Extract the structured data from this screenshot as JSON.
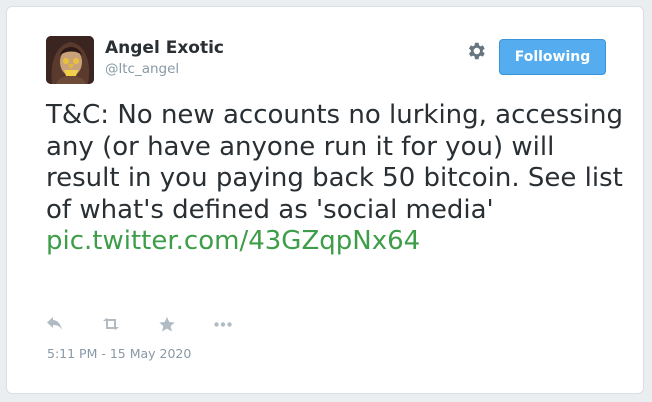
{
  "user": {
    "name": "Angel Exotic",
    "handle": "@ltc_angel",
    "avatar_icon": "profile-photo"
  },
  "header": {
    "settings_icon": "gear-icon",
    "follow_label": "Following"
  },
  "tweet": {
    "text": "T&C: No new accounts no lurking, accessing any (or have anyone run it for you) will result in you paying back 50 bitcoin. See list of what's defined as 'social media'",
    "link": "pic.twitter.com/43GZqpNx64",
    "timestamp": "5:11 PM - 15 May 2020"
  },
  "actions": {
    "icons": [
      "reply-icon",
      "retweet-icon",
      "like-icon",
      "more-icon"
    ]
  },
  "colors": {
    "accent": "#55acee",
    "link": "#3d9d48",
    "text": "#292f33",
    "muted": "#8899a6"
  }
}
